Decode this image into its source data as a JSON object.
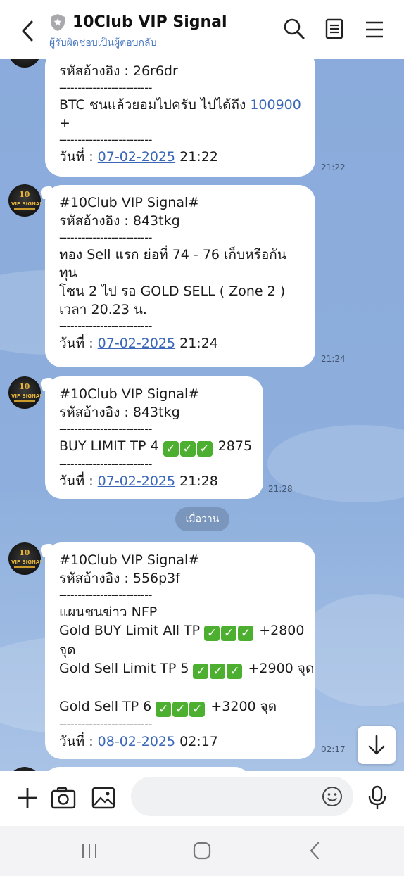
{
  "header": {
    "title": "10Club VIP Signal",
    "subtitle": "ผู้รับผิดชอบเป็นผู้ตอบกลับ",
    "icons": [
      "back-arrow-icon",
      "shield-icon",
      "search-icon",
      "note-icon",
      "menu-icon"
    ]
  },
  "avatar": {
    "logo_top": "10",
    "logo_text": "VIP SIGNAL"
  },
  "messages": [
    {
      "ref": "รหัสอ้างอิง : 26r6dr",
      "sep": "-------------------------",
      "body_prefix": "BTC ชนแล้วยอมไปครับ ไปได้ถึง ",
      "body_link": "100900",
      "body_suffix": "+",
      "date_prefix": "วันที่ : ",
      "date_link": "07-02-2025",
      "date_time": " 21:22",
      "time": "21:22"
    },
    {
      "head": "#10Club VIP Signal#",
      "ref": "รหัสอ้างอิง : 843tkg",
      "sep": "-------------------------",
      "line1": "ทอง Sell แรก ย่อที่ 74 - 76  เก็บหรือกัน",
      "line2": "ทุน",
      "line3": "โซน 2 ไป รอ GOLD SELL  ( Zone 2 )",
      "line4": "เวลา 20.23 น.",
      "date_prefix": "วันที่ : ",
      "date_link": "07-02-2025",
      "date_time": " 21:24",
      "time": "21:24"
    },
    {
      "head": "#10Club VIP Signal#",
      "ref": "รหัสอ้างอิง : 843tkg",
      "sep": "-------------------------",
      "body_prefix": "BUY LIMIT TP 4  ",
      "body_suffix": " 2875",
      "date_prefix": "วันที่ : ",
      "date_link": "07-02-2025",
      "date_time": " 21:28",
      "time": "21:28"
    },
    {
      "head": "#10Club VIP Signal#",
      "ref": "รหัสอ้างอิง : 556p3f",
      "sep": "-------------------------",
      "line1": "แผนชนข่าว NFP",
      "line2_prefix": "Gold BUY Limit  All TP ",
      "line2_suffix": " +2800",
      "line3": "จุด",
      "line4_prefix": "Gold Sell Limit  TP 5 ",
      "line4_suffix": " +2900 จุด",
      "line5_prefix": "Gold Sell TP 6  ",
      "line5_suffix": " +3200 จุด",
      "date_prefix": "วันที่ : ",
      "date_link": "08-02-2025",
      "date_time": " 02:17",
      "time": "02:17"
    }
  ],
  "check_glyph": "✓",
  "date_separator": "เมื่อวาน",
  "scroll_button_icon": "arrow-down-icon",
  "input_bar": {
    "icons": [
      "plus-icon",
      "camera-icon",
      "image-icon",
      "emoji-icon",
      "microphone-icon"
    ]
  },
  "navbar": {
    "icons": [
      "recent-apps-icon",
      "home-icon",
      "back-icon"
    ]
  },
  "colors": {
    "chat_background": "#8aabdb",
    "link": "#3a67b8",
    "subtitle": "#4a78c2",
    "check": "#4caf2f"
  }
}
